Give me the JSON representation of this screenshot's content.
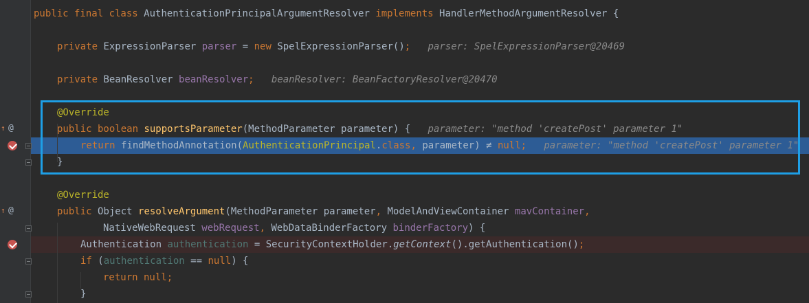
{
  "editor": {
    "lines": [
      {
        "tokens": [
          [
            "kw",
            "public final class "
          ],
          [
            "plain",
            "AuthenticationPrincipalArgumentResolver "
          ],
          [
            "kw",
            "implements "
          ],
          [
            "plain",
            "HandlerMethodArgumentResolver {"
          ]
        ]
      },
      {
        "tokens": []
      },
      {
        "tokens": [
          [
            "kw",
            "private "
          ],
          [
            "plain",
            "ExpressionParser "
          ],
          [
            "field",
            "parser"
          ],
          [
            "plain",
            " = "
          ],
          [
            "kw",
            "new "
          ],
          [
            "plain",
            "SpelExpressionParser()"
          ],
          [
            "kw",
            ";"
          ],
          [
            "hint",
            "   parser: SpelExpressionParser@20469"
          ]
        ]
      },
      {
        "tokens": []
      },
      {
        "tokens": [
          [
            "kw",
            "private "
          ],
          [
            "plain",
            "BeanResolver "
          ],
          [
            "field",
            "beanResolver"
          ],
          [
            "kw",
            ";"
          ],
          [
            "hint",
            "   beanResolver: BeanFactoryResolver@20470"
          ]
        ]
      },
      {
        "tokens": []
      },
      {
        "tokens": [
          [
            "ann",
            "@Override"
          ]
        ]
      },
      {
        "tokens": [
          [
            "kw",
            "public boolean "
          ],
          [
            "fn",
            "supportsParameter"
          ],
          [
            "plain",
            "(MethodParameter parameter) {"
          ],
          [
            "hint",
            "   parameter: \"method 'createPost' parameter 1\""
          ]
        ]
      },
      {
        "tokens": [
          [
            "kw",
            "return "
          ],
          [
            "plain",
            "findMethodAnnotation("
          ],
          [
            "ann",
            "AuthenticationPrincipal"
          ],
          [
            "plain",
            "."
          ],
          [
            "kw",
            "class"
          ],
          [
            "kw",
            ", "
          ],
          [
            "plain",
            "parameter) ≠ "
          ],
          [
            "kw",
            "null;"
          ],
          [
            "hint",
            "   parameter: \"method 'createPost' parameter 1\""
          ]
        ]
      },
      {
        "tokens": [
          [
            "plain",
            "}"
          ]
        ]
      },
      {
        "tokens": []
      },
      {
        "tokens": [
          [
            "ann",
            "@Override"
          ]
        ]
      },
      {
        "tokens": [
          [
            "kw",
            "public "
          ],
          [
            "plain",
            "Object "
          ],
          [
            "fn",
            "resolveArgument"
          ],
          [
            "plain",
            "(MethodParameter parameter"
          ],
          [
            "kw",
            ", "
          ],
          [
            "plain",
            "ModelAndViewContainer "
          ],
          [
            "field",
            "mavContainer"
          ],
          [
            "kw",
            ","
          ]
        ]
      },
      {
        "tokens": [
          [
            "plain",
            "NativeWebRequest "
          ],
          [
            "field",
            "webRequest"
          ],
          [
            "kw",
            ", "
          ],
          [
            "plain",
            "WebDataBinderFactory "
          ],
          [
            "field",
            "binderFactory"
          ],
          [
            "plain",
            ") {"
          ]
        ]
      },
      {
        "tokens": [
          [
            "plain",
            "Authentication "
          ],
          [
            "teal",
            "authentication"
          ],
          [
            "plain",
            " = SecurityContextHolder."
          ],
          [
            "ital",
            "getContext"
          ],
          [
            "plain",
            "().getAuthentication()"
          ],
          [
            "kw",
            ";"
          ]
        ]
      },
      {
        "tokens": [
          [
            "kw",
            "if "
          ],
          [
            "plain",
            "("
          ],
          [
            "teal",
            "authentication"
          ],
          [
            "plain",
            " == "
          ],
          [
            "kw",
            "null"
          ],
          [
            "plain",
            ") {"
          ]
        ]
      },
      {
        "tokens": [
          [
            "kw",
            "return null;"
          ]
        ]
      },
      {
        "tokens": [
          [
            "plain",
            "}"
          ]
        ]
      }
    ]
  },
  "gutter": {
    "override_marker": "@",
    "implements_marker": "↑"
  }
}
